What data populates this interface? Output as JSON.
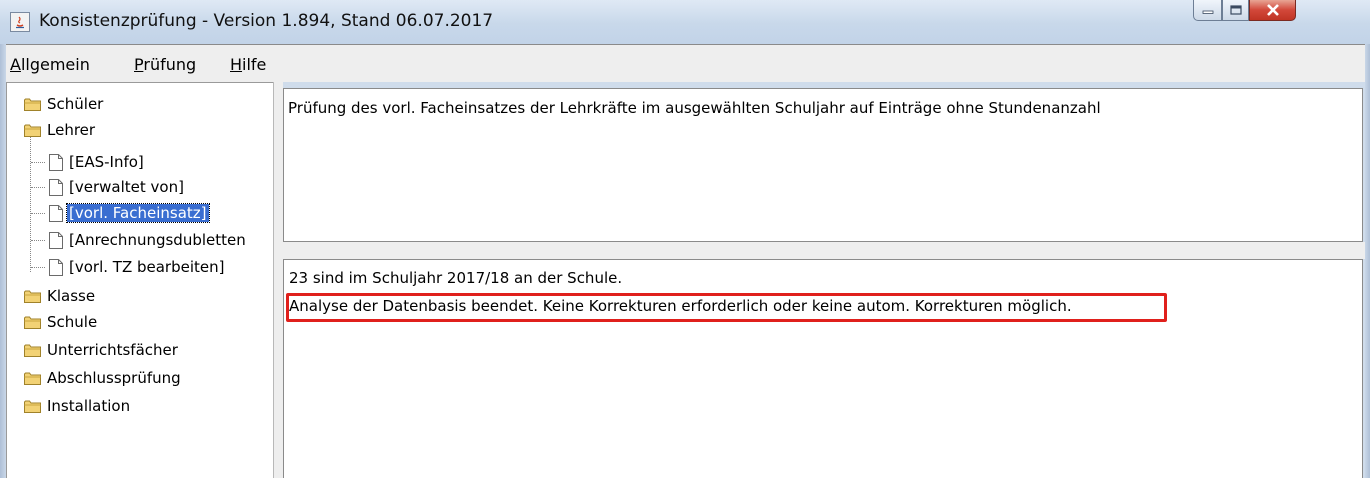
{
  "window": {
    "title": "Konsistenzprüfung - Version 1.894, Stand 06.07.2017",
    "app_icon": "java-app-icon"
  },
  "window_controls": {
    "minimize_icon": "minimize-icon",
    "maximize_icon": "maximize-icon",
    "close_icon": "close-icon"
  },
  "menu": {
    "items": [
      "Allgemein",
      "Prüfung",
      "Hilfe"
    ]
  },
  "tree": {
    "folders": [
      "Schüler",
      "Lehrer",
      "Klasse",
      "Schule",
      "Unterrichtsfächer",
      "Abschlussprüfung",
      "Installation"
    ],
    "lehrer_children": [
      "[EAS-Info]",
      "[verwaltet von]",
      "[vorl. Facheinsatz]",
      "[Anrechnungsdubletten",
      "[vorl. TZ bearbeiten]"
    ],
    "selected": "[vorl. Facheinsatz]"
  },
  "description": {
    "text": "Prüfung des vorl. Facheinsatzes der Lehrkräfte im ausgewählten Schuljahr auf Einträge ohne Stundenanzahl"
  },
  "result": {
    "lines": [
      "23 sind im Schuljahr 2017/18 an der Schule.",
      "Analyse der Datenbasis beendet. Keine Korrekturen erforderlich oder keine autom. Korrekturen möglich."
    ],
    "highlight_color": "#e0201c"
  },
  "colors": {
    "selection": "#3a6ed1",
    "folder": "#e8c35a"
  }
}
